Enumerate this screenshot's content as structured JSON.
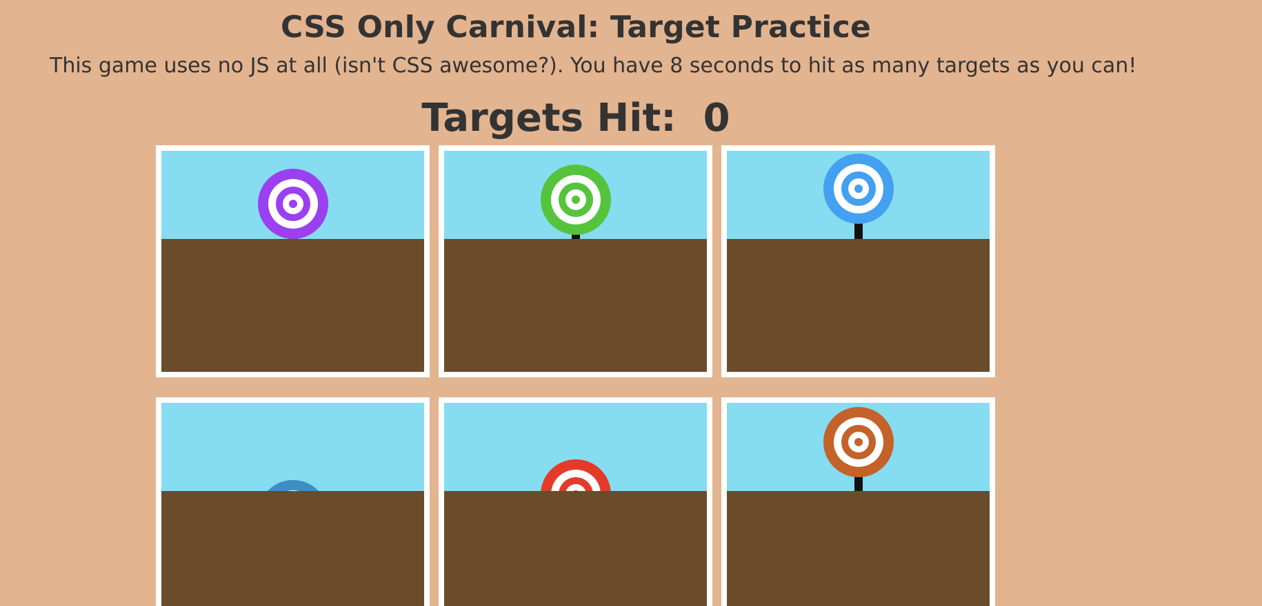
{
  "header": {
    "title": "CSS Only Carnival: Target Practice",
    "subtitle": "This game uses no JS at all (isn't CSS awesome?). You have 8 seconds to hit as many targets as you can!",
    "score_label": "Targets Hit:",
    "score_value": "0"
  },
  "colors": {
    "background": "#e2b490",
    "sky": "#86dcf0",
    "ground": "#6b4c2a",
    "booth_border": "#ffffff",
    "text": "#333333",
    "post": "#111111"
  },
  "booths": [
    {
      "id": "booth-1",
      "target_color": "#9b40f0",
      "target_state": "mostly-raised"
    },
    {
      "id": "booth-2",
      "target_color": "#55c43c",
      "target_state": "mostly-raised"
    },
    {
      "id": "booth-3",
      "target_color": "#44a0f0",
      "target_state": "raised"
    },
    {
      "id": "booth-4",
      "target_color": "#3d8ec4",
      "target_state": "hidden"
    },
    {
      "id": "booth-5",
      "target_color": "#e53a2a",
      "target_state": "rising"
    },
    {
      "id": "booth-6",
      "target_color": "#c4622a",
      "target_state": "raised"
    }
  ]
}
